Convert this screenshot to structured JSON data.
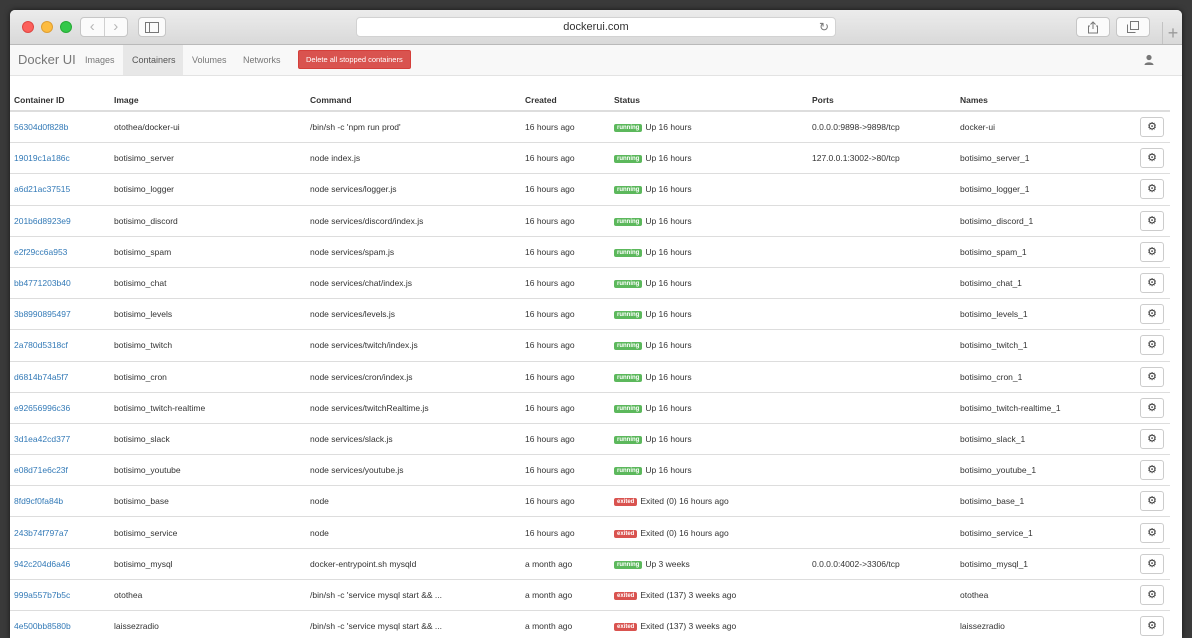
{
  "browser": {
    "url": "dockerui.com",
    "nav_back": "‹",
    "nav_forward": "›",
    "new_tab": "+"
  },
  "app": {
    "brand": "Docker UI",
    "nav": [
      "Images",
      "Containers",
      "Volumes",
      "Networks"
    ],
    "active_nav": "Containers",
    "delete_button": "Delete all stopped containers"
  },
  "table": {
    "columns": [
      "Container ID",
      "Image",
      "Command",
      "Created",
      "Status",
      "Ports",
      "Names"
    ],
    "rows": [
      {
        "id": "56304d0f828b",
        "image": "otothea/docker-ui",
        "command": "/bin/sh -c 'npm run prod'",
        "created": "16 hours ago",
        "state": "running",
        "status": "Up 16 hours",
        "ports": "0.0.0.0:9898->9898/tcp",
        "name": "docker-ui"
      },
      {
        "id": "19019c1a186c",
        "image": "botisimo_server",
        "command": "node index.js",
        "created": "16 hours ago",
        "state": "running",
        "status": "Up 16 hours",
        "ports": "127.0.0.1:3002->80/tcp",
        "name": "botisimo_server_1"
      },
      {
        "id": "a6d21ac37515",
        "image": "botisimo_logger",
        "command": "node services/logger.js",
        "created": "16 hours ago",
        "state": "running",
        "status": "Up 16 hours",
        "ports": "",
        "name": "botisimo_logger_1"
      },
      {
        "id": "201b6d8923e9",
        "image": "botisimo_discord",
        "command": "node services/discord/index.js",
        "created": "16 hours ago",
        "state": "running",
        "status": "Up 16 hours",
        "ports": "",
        "name": "botisimo_discord_1"
      },
      {
        "id": "e2f29cc6a953",
        "image": "botisimo_spam",
        "command": "node services/spam.js",
        "created": "16 hours ago",
        "state": "running",
        "status": "Up 16 hours",
        "ports": "",
        "name": "botisimo_spam_1"
      },
      {
        "id": "bb4771203b40",
        "image": "botisimo_chat",
        "command": "node services/chat/index.js",
        "created": "16 hours ago",
        "state": "running",
        "status": "Up 16 hours",
        "ports": "",
        "name": "botisimo_chat_1"
      },
      {
        "id": "3b8990895497",
        "image": "botisimo_levels",
        "command": "node services/levels.js",
        "created": "16 hours ago",
        "state": "running",
        "status": "Up 16 hours",
        "ports": "",
        "name": "botisimo_levels_1"
      },
      {
        "id": "2a780d5318cf",
        "image": "botisimo_twitch",
        "command": "node services/twitch/index.js",
        "created": "16 hours ago",
        "state": "running",
        "status": "Up 16 hours",
        "ports": "",
        "name": "botisimo_twitch_1"
      },
      {
        "id": "d6814b74a5f7",
        "image": "botisimo_cron",
        "command": "node services/cron/index.js",
        "created": "16 hours ago",
        "state": "running",
        "status": "Up 16 hours",
        "ports": "",
        "name": "botisimo_cron_1"
      },
      {
        "id": "e92656996c36",
        "image": "botisimo_twitch-realtime",
        "command": "node services/twitchRealtime.js",
        "created": "16 hours ago",
        "state": "running",
        "status": "Up 16 hours",
        "ports": "",
        "name": "botisimo_twitch-realtime_1"
      },
      {
        "id": "3d1ea42cd377",
        "image": "botisimo_slack",
        "command": "node services/slack.js",
        "created": "16 hours ago",
        "state": "running",
        "status": "Up 16 hours",
        "ports": "",
        "name": "botisimo_slack_1"
      },
      {
        "id": "e08d71e6c23f",
        "image": "botisimo_youtube",
        "command": "node services/youtube.js",
        "created": "16 hours ago",
        "state": "running",
        "status": "Up 16 hours",
        "ports": "",
        "name": "botisimo_youtube_1"
      },
      {
        "id": "8fd9cf0fa84b",
        "image": "botisimo_base",
        "command": "node",
        "created": "16 hours ago",
        "state": "exited",
        "status": "Exited (0) 16 hours ago",
        "ports": "",
        "name": "botisimo_base_1"
      },
      {
        "id": "243b74f797a7",
        "image": "botisimo_service",
        "command": "node",
        "created": "16 hours ago",
        "state": "exited",
        "status": "Exited (0) 16 hours ago",
        "ports": "",
        "name": "botisimo_service_1"
      },
      {
        "id": "942c204d6a46",
        "image": "botisimo_mysql",
        "command": "docker-entrypoint.sh mysqld",
        "created": "a month ago",
        "state": "running",
        "status": "Up 3 weeks",
        "ports": "0.0.0.0:4002->3306/tcp",
        "name": "botisimo_mysql_1"
      },
      {
        "id": "999a557b7b5c",
        "image": "otothea",
        "command": "/bin/sh -c 'service mysql start && ...",
        "created": "a month ago",
        "state": "exited",
        "status": "Exited (137) 3 weeks ago",
        "ports": "",
        "name": "otothea"
      },
      {
        "id": "4e500bb8580b",
        "image": "laissezradio",
        "command": "/bin/sh -c 'service mysql start && ...",
        "created": "a month ago",
        "state": "exited",
        "status": "Exited (137) 3 weeks ago",
        "ports": "",
        "name": "laissezradio"
      }
    ]
  },
  "colors": {
    "running": "#5cb85c",
    "exited": "#d9534f",
    "link": "#337ab7"
  },
  "icons": {
    "row_action": "gear-icon",
    "user": "user-icon"
  }
}
